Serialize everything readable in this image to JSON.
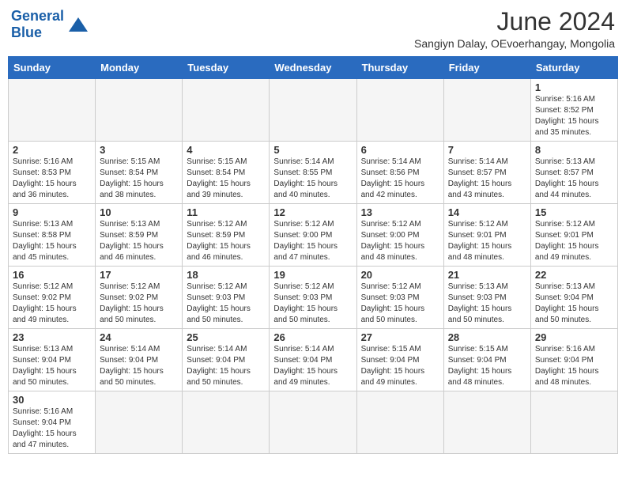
{
  "header": {
    "logo_general": "General",
    "logo_blue": "Blue",
    "month_year": "June 2024",
    "location": "Sangiyn Dalay, OEvoerhangay, Mongolia"
  },
  "weekdays": [
    "Sunday",
    "Monday",
    "Tuesday",
    "Wednesday",
    "Thursday",
    "Friday",
    "Saturday"
  ],
  "weeks": [
    [
      {
        "day": "",
        "info": ""
      },
      {
        "day": "",
        "info": ""
      },
      {
        "day": "",
        "info": ""
      },
      {
        "day": "",
        "info": ""
      },
      {
        "day": "",
        "info": ""
      },
      {
        "day": "",
        "info": ""
      },
      {
        "day": "1",
        "info": "Sunrise: 5:16 AM\nSunset: 8:52 PM\nDaylight: 15 hours\nand 35 minutes."
      }
    ],
    [
      {
        "day": "2",
        "info": "Sunrise: 5:16 AM\nSunset: 8:53 PM\nDaylight: 15 hours\nand 36 minutes."
      },
      {
        "day": "3",
        "info": "Sunrise: 5:15 AM\nSunset: 8:54 PM\nDaylight: 15 hours\nand 38 minutes."
      },
      {
        "day": "4",
        "info": "Sunrise: 5:15 AM\nSunset: 8:54 PM\nDaylight: 15 hours\nand 39 minutes."
      },
      {
        "day": "5",
        "info": "Sunrise: 5:14 AM\nSunset: 8:55 PM\nDaylight: 15 hours\nand 40 minutes."
      },
      {
        "day": "6",
        "info": "Sunrise: 5:14 AM\nSunset: 8:56 PM\nDaylight: 15 hours\nand 42 minutes."
      },
      {
        "day": "7",
        "info": "Sunrise: 5:14 AM\nSunset: 8:57 PM\nDaylight: 15 hours\nand 43 minutes."
      },
      {
        "day": "8",
        "info": "Sunrise: 5:13 AM\nSunset: 8:57 PM\nDaylight: 15 hours\nand 44 minutes."
      }
    ],
    [
      {
        "day": "9",
        "info": "Sunrise: 5:13 AM\nSunset: 8:58 PM\nDaylight: 15 hours\nand 45 minutes."
      },
      {
        "day": "10",
        "info": "Sunrise: 5:13 AM\nSunset: 8:59 PM\nDaylight: 15 hours\nand 46 minutes."
      },
      {
        "day": "11",
        "info": "Sunrise: 5:12 AM\nSunset: 8:59 PM\nDaylight: 15 hours\nand 46 minutes."
      },
      {
        "day": "12",
        "info": "Sunrise: 5:12 AM\nSunset: 9:00 PM\nDaylight: 15 hours\nand 47 minutes."
      },
      {
        "day": "13",
        "info": "Sunrise: 5:12 AM\nSunset: 9:00 PM\nDaylight: 15 hours\nand 48 minutes."
      },
      {
        "day": "14",
        "info": "Sunrise: 5:12 AM\nSunset: 9:01 PM\nDaylight: 15 hours\nand 48 minutes."
      },
      {
        "day": "15",
        "info": "Sunrise: 5:12 AM\nSunset: 9:01 PM\nDaylight: 15 hours\nand 49 minutes."
      }
    ],
    [
      {
        "day": "16",
        "info": "Sunrise: 5:12 AM\nSunset: 9:02 PM\nDaylight: 15 hours\nand 49 minutes."
      },
      {
        "day": "17",
        "info": "Sunrise: 5:12 AM\nSunset: 9:02 PM\nDaylight: 15 hours\nand 50 minutes."
      },
      {
        "day": "18",
        "info": "Sunrise: 5:12 AM\nSunset: 9:03 PM\nDaylight: 15 hours\nand 50 minutes."
      },
      {
        "day": "19",
        "info": "Sunrise: 5:12 AM\nSunset: 9:03 PM\nDaylight: 15 hours\nand 50 minutes."
      },
      {
        "day": "20",
        "info": "Sunrise: 5:12 AM\nSunset: 9:03 PM\nDaylight: 15 hours\nand 50 minutes."
      },
      {
        "day": "21",
        "info": "Sunrise: 5:13 AM\nSunset: 9:03 PM\nDaylight: 15 hours\nand 50 minutes."
      },
      {
        "day": "22",
        "info": "Sunrise: 5:13 AM\nSunset: 9:04 PM\nDaylight: 15 hours\nand 50 minutes."
      }
    ],
    [
      {
        "day": "23",
        "info": "Sunrise: 5:13 AM\nSunset: 9:04 PM\nDaylight: 15 hours\nand 50 minutes."
      },
      {
        "day": "24",
        "info": "Sunrise: 5:14 AM\nSunset: 9:04 PM\nDaylight: 15 hours\nand 50 minutes."
      },
      {
        "day": "25",
        "info": "Sunrise: 5:14 AM\nSunset: 9:04 PM\nDaylight: 15 hours\nand 50 minutes."
      },
      {
        "day": "26",
        "info": "Sunrise: 5:14 AM\nSunset: 9:04 PM\nDaylight: 15 hours\nand 49 minutes."
      },
      {
        "day": "27",
        "info": "Sunrise: 5:15 AM\nSunset: 9:04 PM\nDaylight: 15 hours\nand 49 minutes."
      },
      {
        "day": "28",
        "info": "Sunrise: 5:15 AM\nSunset: 9:04 PM\nDaylight: 15 hours\nand 48 minutes."
      },
      {
        "day": "29",
        "info": "Sunrise: 5:16 AM\nSunset: 9:04 PM\nDaylight: 15 hours\nand 48 minutes."
      }
    ],
    [
      {
        "day": "30",
        "info": "Sunrise: 5:16 AM\nSunset: 9:04 PM\nDaylight: 15 hours\nand 47 minutes."
      },
      {
        "day": "",
        "info": ""
      },
      {
        "day": "",
        "info": ""
      },
      {
        "day": "",
        "info": ""
      },
      {
        "day": "",
        "info": ""
      },
      {
        "day": "",
        "info": ""
      },
      {
        "day": "",
        "info": ""
      }
    ]
  ]
}
